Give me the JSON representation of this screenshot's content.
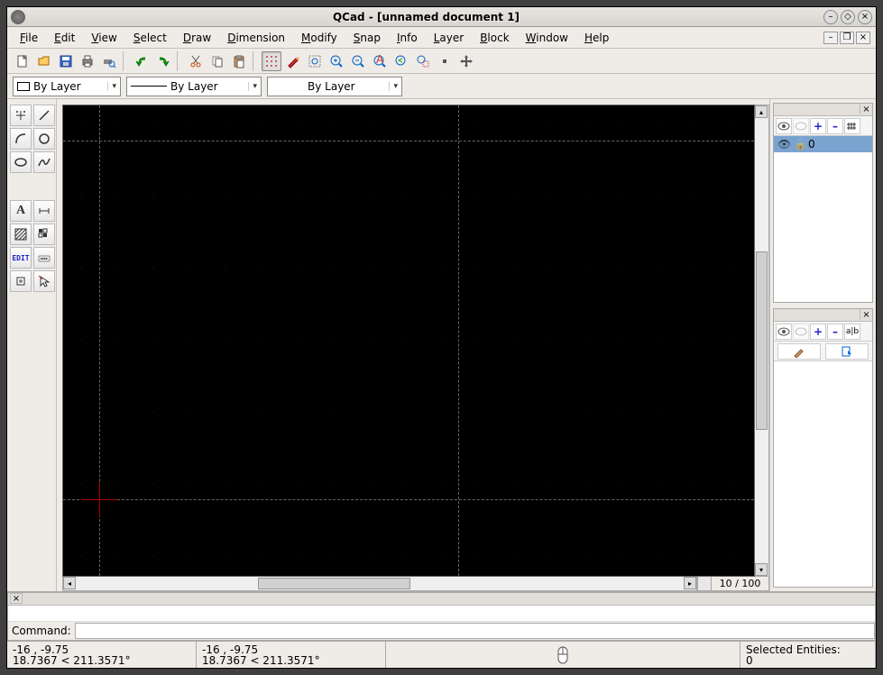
{
  "titlebar": {
    "title": "QCad - [unnamed document 1]"
  },
  "menubar": {
    "items": [
      {
        "label": "File",
        "ul": "F"
      },
      {
        "label": "Edit",
        "ul": "E"
      },
      {
        "label": "View",
        "ul": "V"
      },
      {
        "label": "Select",
        "ul": "S"
      },
      {
        "label": "Draw",
        "ul": "D"
      },
      {
        "label": "Dimension",
        "ul": "D"
      },
      {
        "label": "Modify",
        "ul": "M"
      },
      {
        "label": "Snap",
        "ul": "S"
      },
      {
        "label": "Info",
        "ul": "I"
      },
      {
        "label": "Layer",
        "ul": "L"
      },
      {
        "label": "Block",
        "ul": "B"
      },
      {
        "label": "Window",
        "ul": "W"
      },
      {
        "label": "Help",
        "ul": "H"
      }
    ]
  },
  "properties": {
    "color_label": "By Layer",
    "linetype_label": "By Layer",
    "lineweight_label": "By Layer"
  },
  "layers": {
    "active": {
      "name": "0"
    }
  },
  "command": {
    "label": "Command:"
  },
  "status": {
    "coord1_a": "-16 , -9.75",
    "coord1_b": "18.7367 < 211.3571°",
    "coord2_a": "-16 , -9.75",
    "coord2_b": "18.7367 < 211.3571°",
    "selected_label": "Selected Entities:",
    "selected_count": "0"
  },
  "grid_info": "10 / 100",
  "ptool": {
    "plus": "+",
    "minus": "–"
  }
}
